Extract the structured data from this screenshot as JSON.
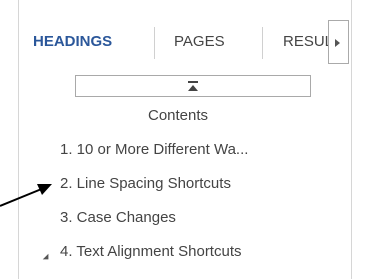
{
  "tabs": [
    {
      "label": "HEADINGS",
      "active": true
    },
    {
      "label": "PAGES",
      "active": false
    },
    {
      "label": "RESULTS",
      "active": false
    }
  ],
  "headings": [
    {
      "label": "Contents"
    },
    {
      "label": "1. 10 or More Different Wa..."
    },
    {
      "label": "2. Line Spacing Shortcuts"
    },
    {
      "label": "3. Case Changes"
    },
    {
      "label": "4. Text Alignment Shortcuts"
    }
  ],
  "colors": {
    "active_tab": "#2b579a",
    "text": "#444444",
    "arrow": "#000000"
  },
  "icons": {
    "tab_scroll": "chevron-right-icon",
    "collapse_all": "collapse-all-icon",
    "expander": "expanded-triangle-icon",
    "callout": "callout-arrow-icon"
  }
}
